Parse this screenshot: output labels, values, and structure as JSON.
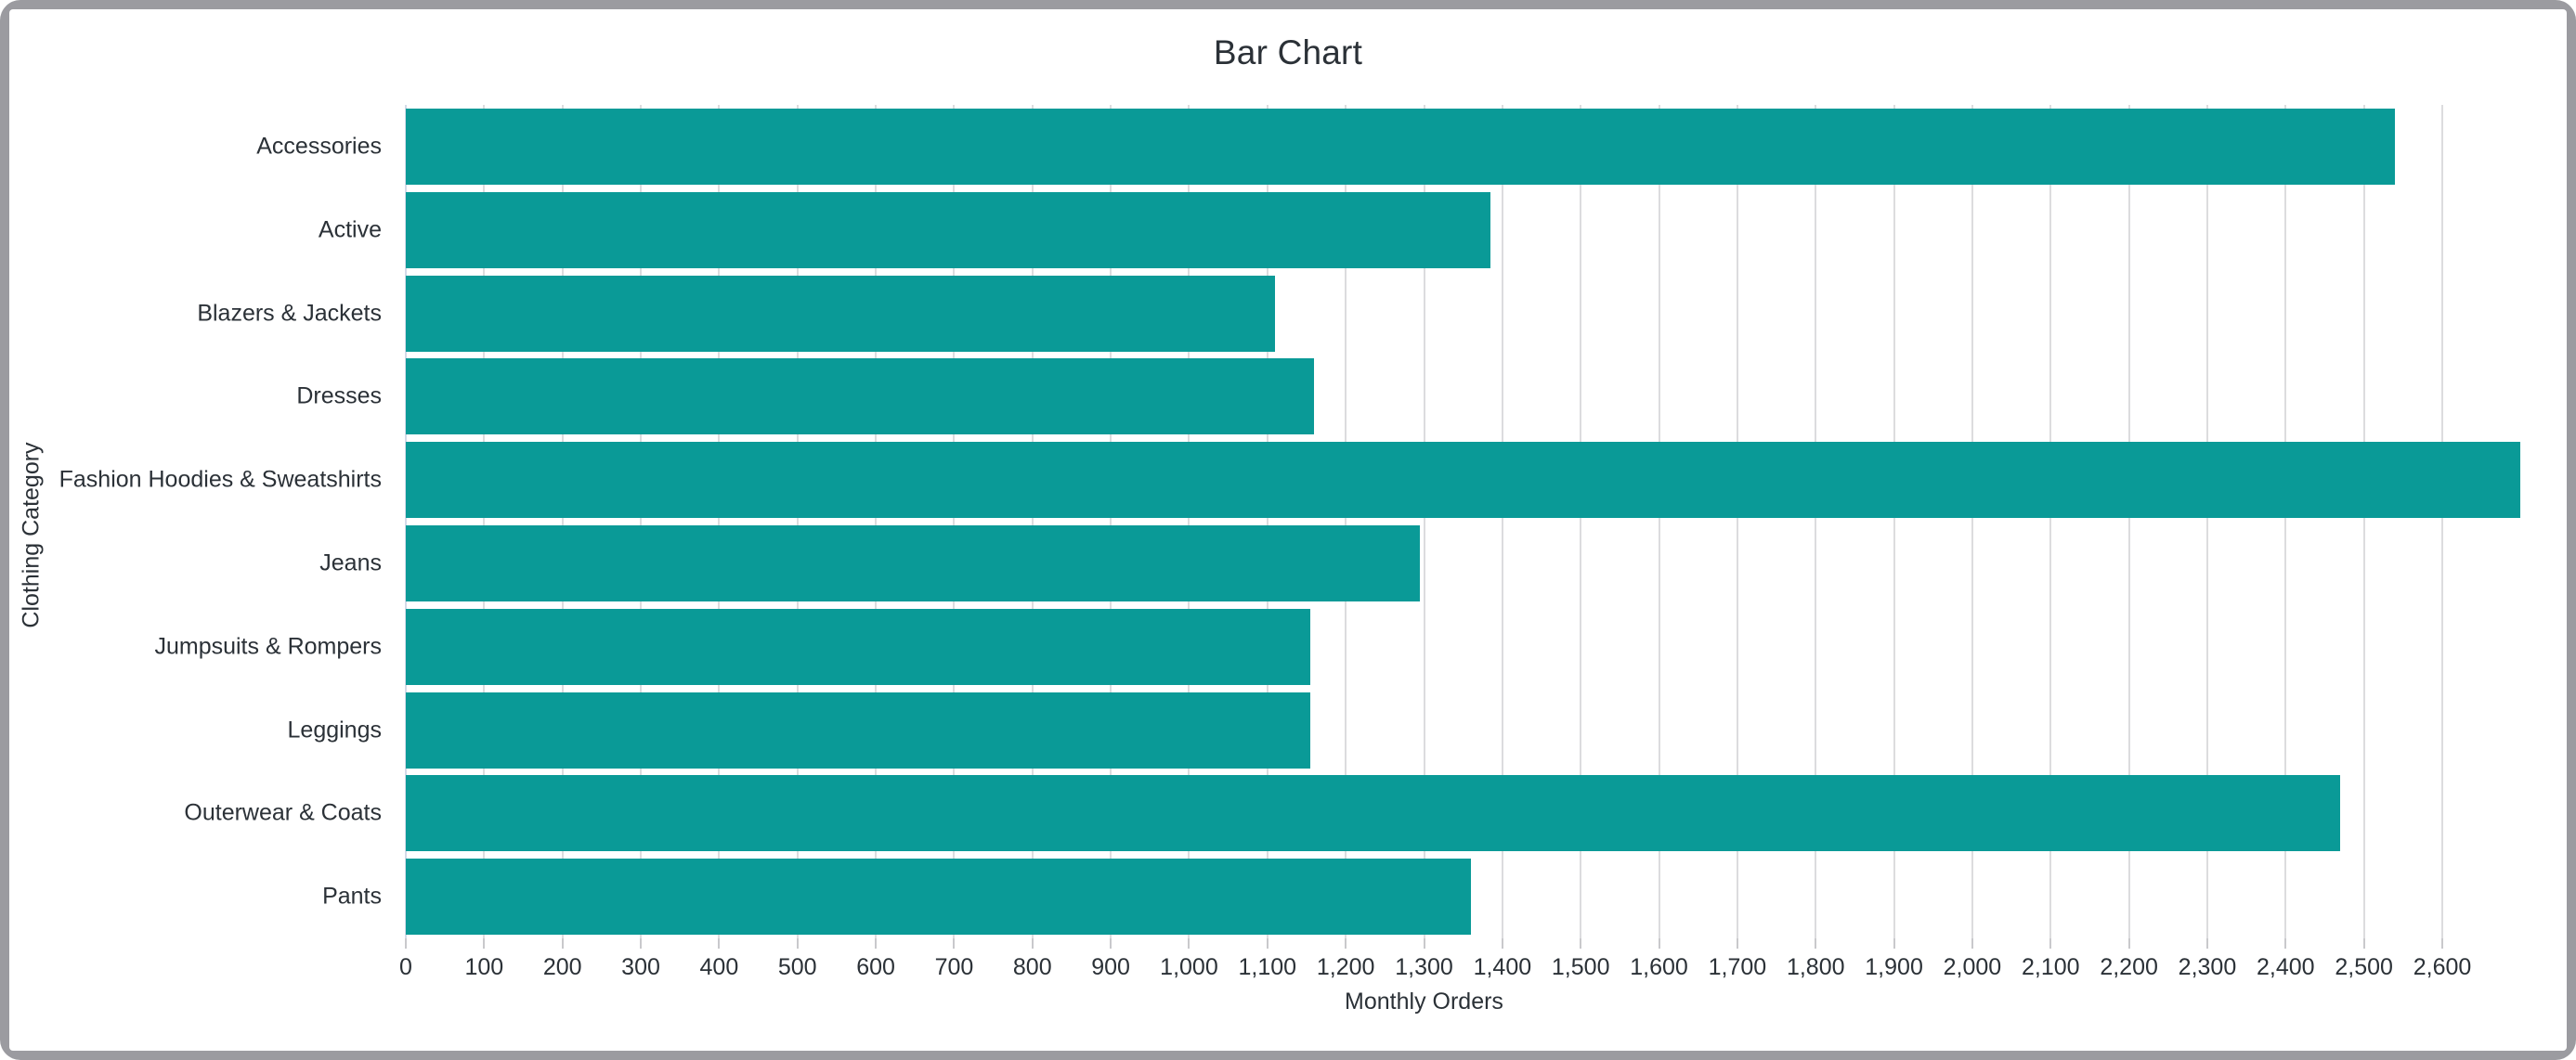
{
  "window": {
    "frame_color": "#9b9ba0",
    "surface_color": "#ffffff"
  },
  "chart_data": {
    "type": "bar",
    "orientation": "horizontal",
    "title": "Bar Chart",
    "xlabel": "Monthly Orders",
    "ylabel": "Clothing Category",
    "categories": [
      "Accessories",
      "Active",
      "Blazers & Jackets",
      "Dresses",
      "Fashion Hoodies & Sweatshirts",
      "Jeans",
      "Jumpsuits & Rompers",
      "Leggings",
      "Outerwear & Coats",
      "Pants"
    ],
    "values": [
      2540,
      1385,
      1110,
      1160,
      2700,
      1295,
      1155,
      1155,
      2470,
      1360
    ],
    "xlim": [
      0,
      2600
    ],
    "x_tick_values": [
      0,
      100,
      200,
      300,
      400,
      500,
      600,
      700,
      800,
      900,
      1000,
      1100,
      1200,
      1300,
      1400,
      1500,
      1600,
      1700,
      1800,
      1900,
      2000,
      2100,
      2200,
      2300,
      2400,
      2500,
      2600
    ],
    "x_tick_labels": [
      "0",
      "100",
      "200",
      "300",
      "400",
      "500",
      "600",
      "700",
      "800",
      "900",
      "1,000",
      "1,100",
      "1,200",
      "1,300",
      "1,400",
      "1,500",
      "1,600",
      "1,700",
      "1,800",
      "1,900",
      "2,000",
      "2,100",
      "2,200",
      "2,300",
      "2,400",
      "2,500",
      "2,600"
    ],
    "grid": true,
    "grid_axis": "x",
    "legend": false,
    "bar_color": "#0a9a97",
    "gridline_color": "#dcdcde",
    "text_color": "#2b3137"
  }
}
